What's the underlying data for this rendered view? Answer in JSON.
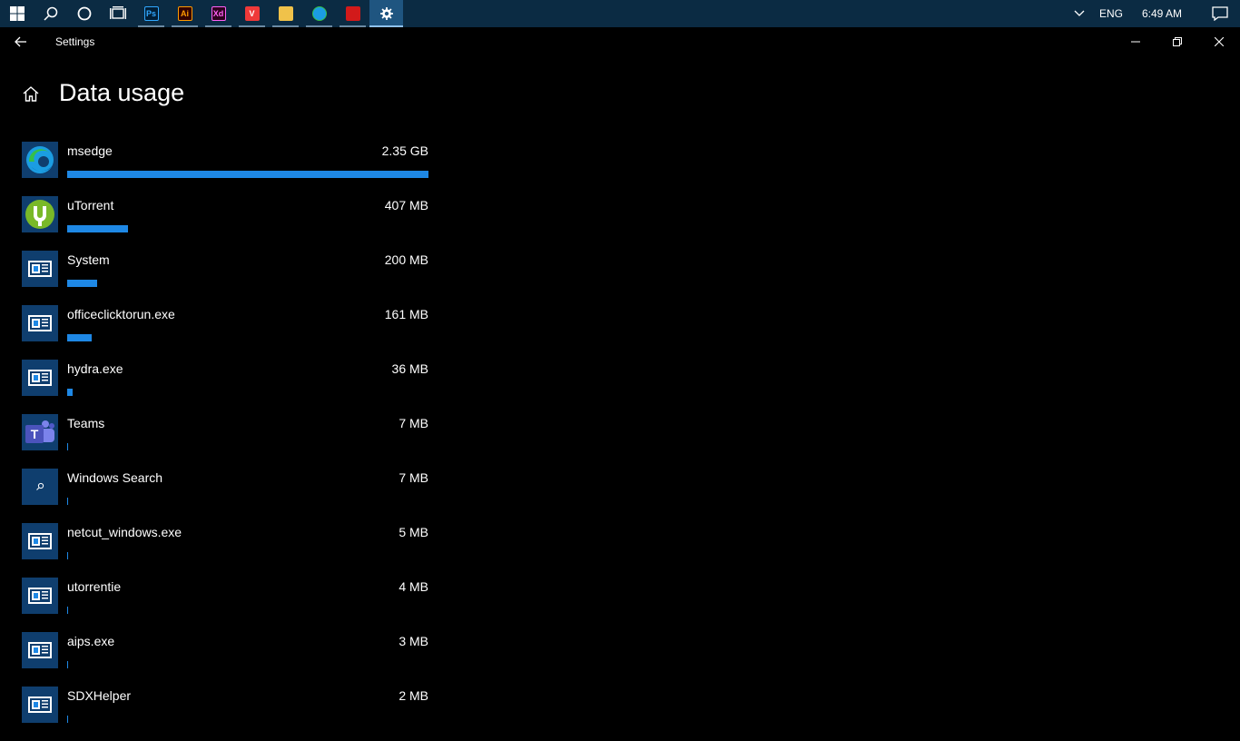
{
  "window": {
    "title": "Settings"
  },
  "page": {
    "title": "Data usage"
  },
  "taskbar": {
    "apps": [
      {
        "name": "photoshop-app",
        "label": "Ps",
        "bg": "#001e36",
        "fg": "#31a8ff",
        "border": "#31a8ff"
      },
      {
        "name": "illustrator-app",
        "label": "Ai",
        "bg": "#330000",
        "fg": "#ff9a00",
        "border": "#ff9a00"
      },
      {
        "name": "xd-app",
        "label": "Xd",
        "bg": "#2e001f",
        "fg": "#ff61f6",
        "border": "#ff61f6"
      },
      {
        "name": "vivaldi-app",
        "label": "V",
        "bg": "#ef3939",
        "fg": "#ffffff",
        "border": "#ef3939"
      },
      {
        "name": "file-explorer-app",
        "label": "",
        "bg": "#f0c24a",
        "fg": "#ffffff",
        "border": "#f0c24a"
      },
      {
        "name": "edge-app",
        "label": "",
        "bg": "#1b9de2",
        "fg": "#ffffff",
        "border": "#35c04a"
      },
      {
        "name": "acrobat-app",
        "label": "",
        "bg": "#d21a1a",
        "fg": "#ffffff",
        "border": "#d21a1a"
      }
    ],
    "language": "ENG",
    "clock": "6:49 AM"
  },
  "colors": {
    "accent": "#1e88e5",
    "tile": "#0f3e6e",
    "taskbar": "#0b2b43"
  },
  "usage_max_mb": 2406,
  "items": [
    {
      "name": "msedge",
      "size": "2.35 GB",
      "mb": 2406,
      "icon": "edge"
    },
    {
      "name": "uTorrent",
      "size": "407 MB",
      "mb": 407,
      "icon": "utorrent"
    },
    {
      "name": "System",
      "size": "200 MB",
      "mb": 200,
      "icon": "generic"
    },
    {
      "name": "officeclicktorun.exe",
      "size": "161 MB",
      "mb": 161,
      "icon": "generic"
    },
    {
      "name": "hydra.exe",
      "size": "36 MB",
      "mb": 36,
      "icon": "generic"
    },
    {
      "name": "Teams",
      "size": "7 MB",
      "mb": 7,
      "icon": "teams"
    },
    {
      "name": "Windows Search",
      "size": "7 MB",
      "mb": 7,
      "icon": "search"
    },
    {
      "name": "netcut_windows.exe",
      "size": "5 MB",
      "mb": 5,
      "icon": "generic"
    },
    {
      "name": "utorrentie",
      "size": "4 MB",
      "mb": 4,
      "icon": "generic"
    },
    {
      "name": "aips.exe",
      "size": "3 MB",
      "mb": 3,
      "icon": "generic"
    },
    {
      "name": "SDXHelper",
      "size": "2 MB",
      "mb": 2,
      "icon": "generic"
    }
  ]
}
